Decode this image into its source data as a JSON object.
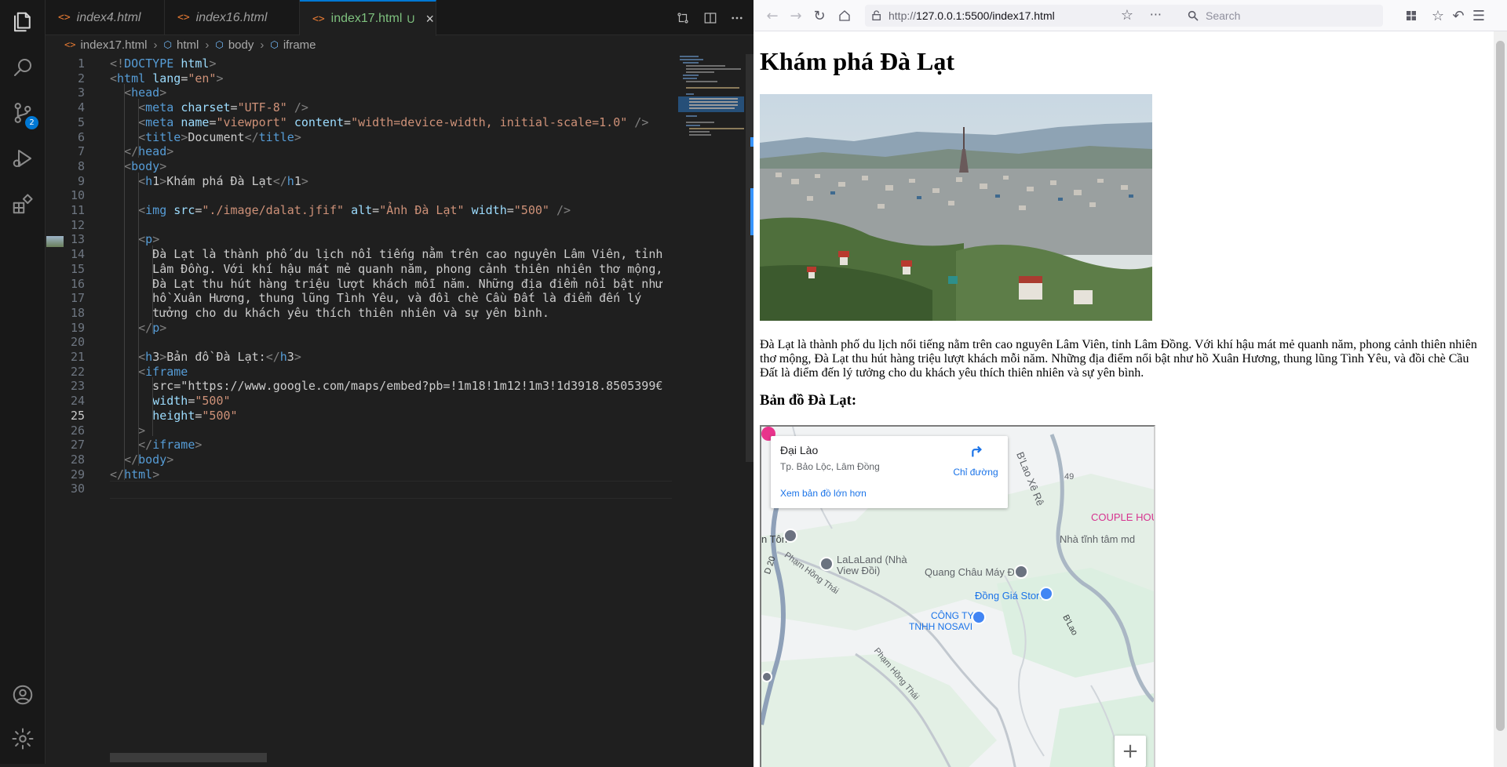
{
  "editor": {
    "tabs": [
      {
        "label": "index4.html",
        "icon": "<>"
      },
      {
        "label": "index16.html",
        "icon": "<>"
      },
      {
        "label": "index17.html",
        "icon": "<>",
        "status": "U",
        "close": "×"
      }
    ],
    "breadcrumb": {
      "file": "index17.html",
      "items": [
        "html",
        "body",
        "iframe"
      ]
    },
    "activity_badge": "2",
    "current_line": 25,
    "line_numbers": [
      "1",
      "2",
      "3",
      "4",
      "5",
      "6",
      "7",
      "8",
      "9",
      "10",
      "11",
      "12",
      "13",
      "14",
      "15",
      "16",
      "17",
      "18",
      "19",
      "20",
      "21",
      "22",
      "23",
      "24",
      "25",
      "26",
      "27",
      "28",
      "29",
      "30"
    ],
    "code_lines": [
      "<!DOCTYPE html>",
      "<html lang=\"en\">",
      "  <head>",
      "    <meta charset=\"UTF-8\" />",
      "    <meta name=\"viewport\" content=\"width=device-width, initial-scale=1.0\" />",
      "    <title>Document</title>",
      "  </head>",
      "  <body>",
      "    <h1>Khám phá Đà Lạt</h1>",
      "",
      "    <img src=\"./image/dalat.jfif\" alt=\"Ảnh Đà Lạt\" width=\"500\" />",
      "",
      "    <p>",
      "      Đà Lạt là thành phố du lịch nổi tiếng nằm trên cao nguyên Lâm Viên, tỉnh",
      "      Lâm Đồng. Với khí hậu mát mẻ quanh năm, phong cảnh thiên nhiên thơ mộng,",
      "      Đà Lạt thu hút hàng triệu lượt khách mỗi năm. Những địa điểm nổi bật như",
      "      hồ Xuân Hương, thung lũng Tình Yêu, và đồi chè Cầu Đất là điểm đến lý",
      "      tưởng cho du khách yêu thích thiên nhiên và sự yên bình.",
      "    </p>",
      "",
      "    <h3>Bản đồ Đà Lạt:</h3>",
      "    <iframe",
      "      src=\"https://www.google.com/maps/embed?pb=!1m18!1m12!1m3!1d3918.8505399€",
      "      width=\"500\"",
      "      height=\"500\"",
      "    >",
      "    </iframe>",
      "  </body>",
      "</html>",
      ""
    ]
  },
  "browser": {
    "url_host": "http://",
    "url_rest": "127.0.0.1:5500/index17.html",
    "search_placeholder": "Search",
    "page": {
      "h1": "Khám phá Đà Lạt",
      "paragraph": "Đà Lạt là thành phố du lịch nổi tiếng nằm trên cao nguyên Lâm Viên, tỉnh Lâm Đồng. Với khí hậu mát mẻ quanh năm, phong cảnh thiên nhiên thơ mộng, Đà Lạt thu hút hàng triệu lượt khách mỗi năm. Những địa điểm nổi bật như hồ Xuân Hương, thung lũng Tình Yêu, và đồi chè Cầu Đất là điểm đến lý tưởng cho du khách yêu thích thiên nhiên và sự yên bình.",
      "h3": "Bản đồ Đà Lạt:"
    },
    "map": {
      "place_title": "Đại Lào",
      "place_sub": "Tp. Bảo Lộc, Lâm Đồng",
      "directions": "Chỉ đường",
      "larger_map": "Xem bản đồ lớn hơn",
      "zoom_in": "+",
      "labels": [
        "B'Lao Xê Rê",
        "49",
        "COUPLE HOU",
        "Nhà tĩnh tâm md",
        "n Tôn",
        "LaLaLand (Nhà",
        "View Đồi)",
        "Quang Châu Máy Đào",
        "Đồng Giá Store",
        "CÔNG TY",
        "TNHH NOSAVI",
        "Phạm Hồng Thái",
        "Phạm Hồng Thái",
        "B'Lao",
        "D 20",
        "Phạm Hồng Thái"
      ]
    }
  }
}
